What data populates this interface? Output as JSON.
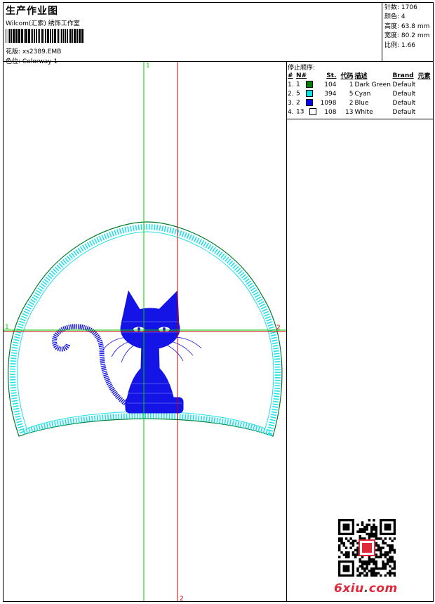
{
  "header": {
    "title": "生产作业图",
    "company": "Wilcom(汇索) 绣饰工作室",
    "design_label": "花版:",
    "design_value": "xs2389.EMB",
    "color_label": "色位:",
    "color_value": "Colorway 1"
  },
  "stats": {
    "stitches": {
      "label": "针数:",
      "value": "1706"
    },
    "colors": {
      "label": "颜色:",
      "value": "4"
    },
    "height": {
      "label": "高度:",
      "value": "63.8 mm"
    },
    "width": {
      "label": "宽度:",
      "value": "80.2 mm"
    },
    "scale": {
      "label": "比例:",
      "value": "1.66"
    }
  },
  "stop_sequence": {
    "title": "停止顺序:",
    "columns": [
      "#",
      "N#",
      "St.",
      "代码",
      "描述",
      "Brand",
      "元素"
    ],
    "rows": [
      {
        "idx": "1.",
        "n": "1",
        "swatch": "#008000",
        "st": "104",
        "code": "1",
        "desc": "Dark Green",
        "brand": "Default"
      },
      {
        "idx": "2.",
        "n": "5",
        "swatch": "#00e5e5",
        "st": "394",
        "code": "5",
        "desc": "Cyan",
        "brand": "Default"
      },
      {
        "idx": "3.",
        "n": "2",
        "swatch": "#0000ff",
        "st": "1098",
        "code": "2",
        "desc": "Blue",
        "brand": "Default"
      },
      {
        "idx": "4.",
        "n": "13",
        "swatch": "#ffffff",
        "st": "108",
        "code": "13",
        "desc": "White",
        "brand": "Default"
      }
    ]
  },
  "guides": {
    "vertical_top_label": "1",
    "vertical_bottom_label": "2",
    "horizontal_left_label": "1",
    "horizontal_right_label": "2"
  },
  "colors": {
    "green": "#00cc00",
    "red": "#cc0000",
    "cyan": "#1ee0e8",
    "dark_green": "#007a2a",
    "blue": "#1414e6",
    "watermark_red": "#e0283a"
  },
  "watermark": {
    "text_red": "6xiu",
    "text_dot": ".",
    "text_com": "com"
  }
}
